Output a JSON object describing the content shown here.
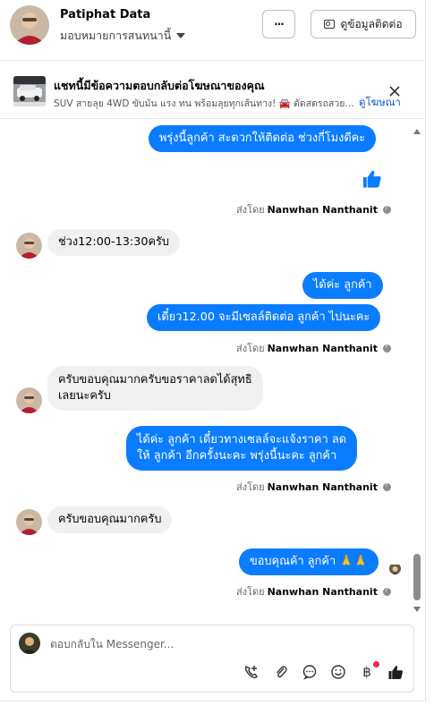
{
  "header": {
    "page_name": "Patiphat Data",
    "assign_label": "มอบหมายการสนทนานี้",
    "more_label": "···",
    "contact_label": "ดูข้อมูลติดต่อ"
  },
  "ad_banner": {
    "title": "แชทนี้มีข้อความตอบกลับต่อโฆษณาของคุณ",
    "description": "SUV สายลุย 4WD ขับมัน แรง ทน พร้อมลุยทุกเส้นทาง! 🚘 ดัดสดรถสวย! E...",
    "link": "ดูโฆษณา",
    "close": "✕"
  },
  "messages": [
    {
      "direction": "out",
      "text": "พรุ่งนี้ลูกค้า สะดวกให้ติดต่อ ช่วงกี่โมงดีคะ"
    },
    {
      "direction": "out",
      "type": "like"
    },
    {
      "type": "sent_by",
      "prefix": "ส่งโดย",
      "name": "Nanwhan Nanthanit"
    },
    {
      "direction": "in",
      "text": "ช่วง12:00-13:30ครับ"
    },
    {
      "direction": "out",
      "text": "ได้ค่ะ  ลูกค้า"
    },
    {
      "direction": "out",
      "text": "เดี๋ยว12.00 จะมีเซลล์ติดต่อ ลูกค้า ไปนะคะ"
    },
    {
      "type": "sent_by",
      "prefix": "ส่งโดย",
      "name": "Nanwhan Nanthanit"
    },
    {
      "direction": "in",
      "text_lines": [
        "ครับขอบคุณมากครับขอราคาลดได้สุทธิ",
        "เลยนะครับ"
      ]
    },
    {
      "direction": "out",
      "text_lines": [
        "ได้ค่ะ  ลูกค้า  เดี๋ยวทางเซลล์จะแจ้งราคา  ลด",
        "ให้ ลูกค้า อีกครั้งนะคะ  พรุ่งนี้นะคะ ลูกค้า"
      ]
    },
    {
      "type": "sent_by",
      "prefix": "ส่งโดย",
      "name": "Nanwhan Nanthanit"
    },
    {
      "direction": "in",
      "text": "ครับขอบคุณมากครับ"
    },
    {
      "direction": "out",
      "text": "ขอบคุณค้า ลูกค้า 🙏🙏"
    },
    {
      "type": "sent_by",
      "prefix": "ส่งโดย",
      "name": "Nanwhan Nanthanit"
    }
  ],
  "composer": {
    "placeholder": "ตอบกลับใน Messenger...",
    "tools": [
      "add-call-icon",
      "paperclip-icon",
      "chat-bubble-icon",
      "emoji-icon",
      "baht-icon",
      "like-icon"
    ]
  },
  "colors": {
    "outgoing_bubble": "#0a7cff",
    "incoming_bubble": "#f0f0f0",
    "link": "#0a58ca",
    "notification_dot": "#f02849"
  }
}
